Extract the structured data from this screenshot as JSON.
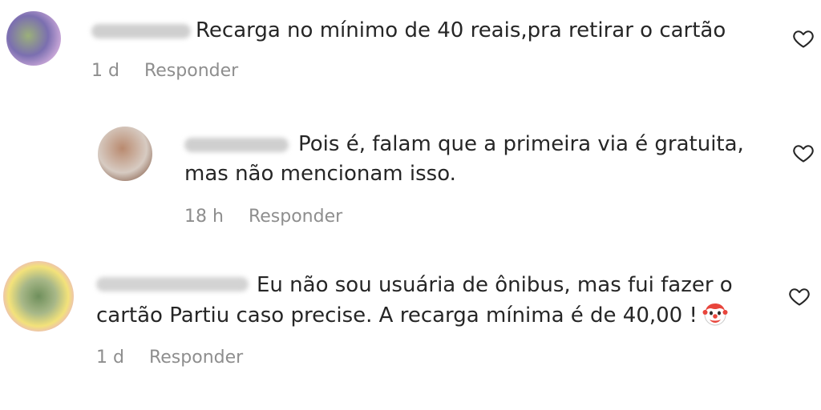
{
  "comments": [
    {
      "text": "Recarga no mínimo de 40 reais,pra retirar o cartão",
      "time": "1 d",
      "reply_label": "Responder",
      "avatar_colors": [
        "#7b6fb0",
        "#9bb07a",
        "#c9a7d8"
      ],
      "like_icon": "heart-outline-icon"
    },
    {
      "text_line1": "Pois é, falam que a primeira via é gratuita,",
      "text_line2": "mas não mencionam isso.",
      "time": "18 h",
      "reply_label": "Responder",
      "avatar_colors": [
        "#b98a6f",
        "#d7cbc2",
        "#8f6b58"
      ],
      "like_icon": "heart-outline-icon"
    },
    {
      "text_line1": "Eu não sou usuária de ônibus, mas fui fazer o",
      "text_line2": "cartão Partiu caso precise. A recarga mínima é de 40,00 !",
      "emoji": "clown-face-emoji",
      "time": "1 d",
      "reply_label": "Responder",
      "avatar_colors": [
        "#e7a0e8",
        "#f3e27a",
        "#6f8f5c"
      ],
      "like_icon": "heart-outline-icon"
    }
  ]
}
